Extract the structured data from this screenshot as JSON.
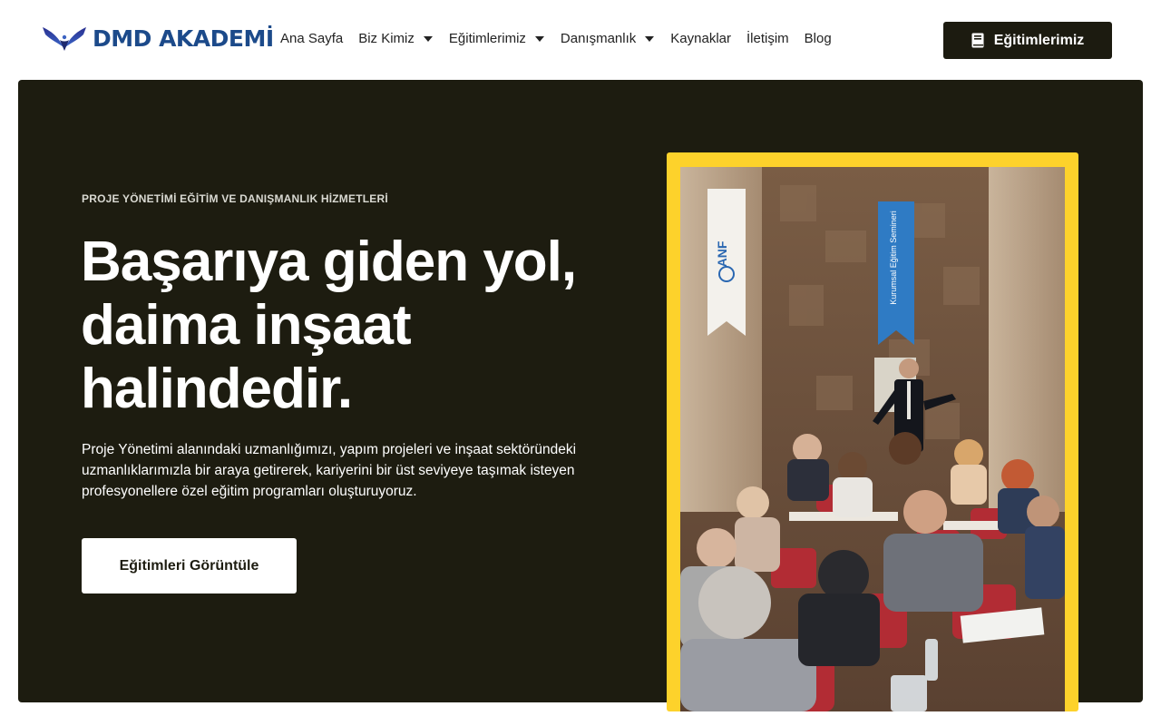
{
  "header": {
    "logo_text": "DMD AKADEMİ",
    "nav": [
      {
        "label": "Ana Sayfa",
        "has_dropdown": false
      },
      {
        "label": "Biz Kimiz",
        "has_dropdown": true
      },
      {
        "label": "Eğitimlerimiz",
        "has_dropdown": true
      },
      {
        "label": "Danışmanlık",
        "has_dropdown": true
      },
      {
        "label": "Kaynaklar",
        "has_dropdown": false
      },
      {
        "label": "İletişim",
        "has_dropdown": false
      },
      {
        "label": "Blog",
        "has_dropdown": false
      }
    ],
    "cta_label": "Eğitimlerimiz",
    "cta_icon": "book-icon"
  },
  "hero": {
    "eyebrow": "PROJE YÖNETİMİ EĞİTİM VE DANIŞMANLIK HİZMETLERİ",
    "headline_lines": [
      "Başarıya giden yol,",
      "daima inşaat",
      "halindedir."
    ],
    "description": "Proje Yönetimi alanındaki uzmanlığımızı, yapım projeleri ve inşaat sektöründeki uzmanlıklarımızla bir araya getirerek, kariyerini bir üst seviyeye taşımak isteyen profesyonellere özel eğitim programları oluşturuyoruz.",
    "button_label": "Eğitimleri Görüntüle",
    "photo": {
      "banner_left_text": "ANF",
      "banner_right_text": "Kurumsal Eğitim Semineri"
    }
  },
  "colors": {
    "dark": "#1d1c10",
    "accent_yellow": "#fdd22b",
    "logo_blue": "#1c4a8a",
    "white": "#ffffff"
  }
}
